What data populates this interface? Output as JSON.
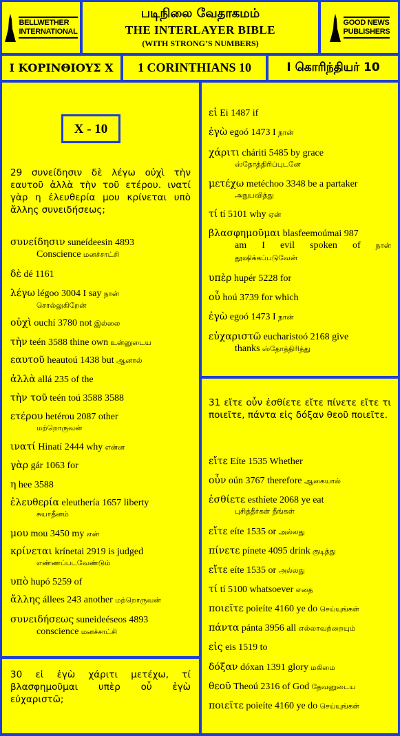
{
  "header": {
    "left_logo": [
      "BELLWETHER",
      "INTERNATIONAL"
    ],
    "right_logo": [
      "GOOD NEWS",
      "PUBLISHERS"
    ],
    "title_tamil": "படிநிலை வேதாகமம்",
    "title_main": "THE  INTERLAYER BIBLE",
    "title_sub": "(WITH STRONG’S NUMBERS)",
    "book_greek": "Ι ΚΟΡΙΝΘΙΟΥΣ Χ",
    "book_english": "1 CORINTHIANS  10",
    "book_tamil": "I கொரிந்தியர் 10"
  },
  "left": {
    "chapter": "X - 10",
    "verse29": "29   συνείδησιν δὲ λέγω οὐχὶ τὴν εαυτοῦ ἀλλὰ τὴν τοῦ ετέρου. ινατί γὰρ η ἐλευθερία μου κρίνεται υπὸ ἄλλης συνειδήσεως;",
    "entries": [
      {
        "g": "συνείδησιν",
        "e": "suneídeesin   4893",
        "c": "Conscience",
        "t": "மனச்சாட்சி"
      },
      {
        "g": "δὲ",
        "e": "dé 1161",
        "c": "",
        "t": ""
      },
      {
        "g": "λέγω",
        "e": "légoo   3004   I say",
        "c": "சொல்லுகிறேன்",
        "t": "நான்"
      },
      {
        "g": "οὐχὶ",
        "e": "ouchí 3780 not",
        "c": "",
        "t": "இல்லை"
      },
      {
        "g": "τὴν",
        "e": "teén 3588  thine own",
        "c": "",
        "t": "உன்னுடைய"
      },
      {
        "g": "εαυτοῦ",
        "e": "heautoú 1438 but",
        "c": "",
        "t": "ஆனால்"
      },
      {
        "g": "ἀλλὰ",
        "e": "allá  235 of the",
        "c": "",
        "t": ""
      },
      {
        "g": "τὴν   τοῦ",
        "e": "teén toú   3588  3588",
        "c": "",
        "t": ""
      },
      {
        "g": "ετέρου",
        "e": "hetérou      2087      other",
        "c": "மற்றொருவன்",
        "t": ""
      },
      {
        "g": "ινατί",
        "e": "Hinatí 2444 why",
        "c": "",
        "t": "என்ன"
      },
      {
        "g": "γὰρ",
        "e": "gár 1063 for",
        "c": "",
        "t": ""
      },
      {
        "g": "η",
        "e": "hee 3588",
        "c": "",
        "t": ""
      },
      {
        "g": "ἐλευθερία",
        "e": "eleuthería   1657   liberty",
        "c": "சுயாதீனம்",
        "t": ""
      },
      {
        "g": "μου",
        "e": "mou   3450 my",
        "c": "",
        "t": "என்"
      },
      {
        "g": "κρίνεται",
        "e": "krínetai   2919   is judged",
        "c": "எண்ணப்படவேண்டும்",
        "t": ""
      },
      {
        "g": "υπὸ",
        "e": "hupó 5259 of",
        "c": "",
        "t": ""
      },
      {
        "g": "ἄλλης",
        "e": "állees 243 another",
        "c": "",
        "t": "மற்றொருவன்"
      },
      {
        "g": "συνειδήσεως",
        "e": "suneideéseos      4893",
        "c": "conscience",
        "t": "மனச்சாட்சி"
      }
    ],
    "verse30": "30    εἰ ἐγὼ χάριτι μετέχω, τί βλασφημοῦμαι υπὲρ οὗ ἐγὼ εὐχαριστῶ;"
  },
  "right": {
    "entries30": [
      {
        "g": "εἰ",
        "e": "Ei 1487 if",
        "c": "",
        "t": ""
      },
      {
        "g": "ἐγὼ",
        "e": "egoó 1473  I",
        "c": "",
        "t": "நான்"
      },
      {
        "g": "χάριτι",
        "e": "cháriti    5485    by    grace",
        "c": "ஸ்தோத்திரிப்புடனே",
        "t": ""
      },
      {
        "g": "μετέχω",
        "e": "metéchoo  3348 be a partaker",
        "c": "அநுபவித்து",
        "t": ""
      },
      {
        "g": "τί",
        "e": "tí   5101  why",
        "c": "",
        "t": "ஏன்"
      },
      {
        "g": "βλασφημοῦμαι",
        "e": "blasfeemoúmai     987",
        "c": "am    I    evil    spoken    of",
        "t": "நான் தூஷிக்கப்படுவேன்"
      },
      {
        "g": "υπὲρ",
        "e": "hupér 5228 for",
        "c": "",
        "t": ""
      },
      {
        "g": "οὗ",
        "e": "hoú 3739 for which",
        "c": "",
        "t": ""
      },
      {
        "g": "ἐγὼ",
        "e": "egoó 1473  I",
        "c": "",
        "t": "நான்"
      },
      {
        "g": "εὐχαριστῶ",
        "e": "eucharistoó   2168   give",
        "c": "thanks",
        "t": "ஸ்தோத்திரித்து"
      }
    ],
    "verse31": "31  εἴτε οὖν ἐσθίετε εἴτε πίνετε εἴτε τι ποιεῖτε, πάντα εἰς δόξαν θεοῦ ποιεῖτε.",
    "entries31": [
      {
        "g": "εἴτε",
        "e": "Eíte 1535 Whether",
        "t": ""
      },
      {
        "g": "οὖν",
        "e": "oún 3767 therefore",
        "t": "ஆகையால்"
      },
      {
        "g": "ἐσθίετε",
        "e": "esthíete  2068   ye eat",
        "t": "நீங்கள்",
        "c": "புசித்தீர்கள்"
      },
      {
        "g": "εἴτε",
        "e": "eíte 1535 or",
        "t": "அல்லது"
      },
      {
        "g": "πίνετε",
        "e": "pínete  4095 drink",
        "t": "குடித்து"
      },
      {
        "g": "εἴτε",
        "e": "eíte 1535 or",
        "t": "அல்லது"
      },
      {
        "g": "τί",
        "e": "tí 5100 whatsoever",
        "t": "எதை"
      },
      {
        "g": "ποιεῖτε",
        "e": "poieíte 4160 ye do",
        "t": "செய்யுங்கள்"
      },
      {
        "g": "πάντα",
        "e": "pánta   3956  all",
        "t": "எல்லாவற்றையும்"
      },
      {
        "g": "εἰς",
        "e": "eis 1519 to",
        "t": ""
      },
      {
        "g": "δόξαν",
        "e": "dóxan 1391 glory",
        "t": "மகிமை"
      },
      {
        "g": "θεοῦ",
        "e": "Theoú 2316 of God",
        "t": "தேவனுடைய"
      },
      {
        "g": "ποιεῖτε",
        "e": "poieíte 4160 ye do",
        "t": "செய்யுங்கள்"
      }
    ]
  }
}
